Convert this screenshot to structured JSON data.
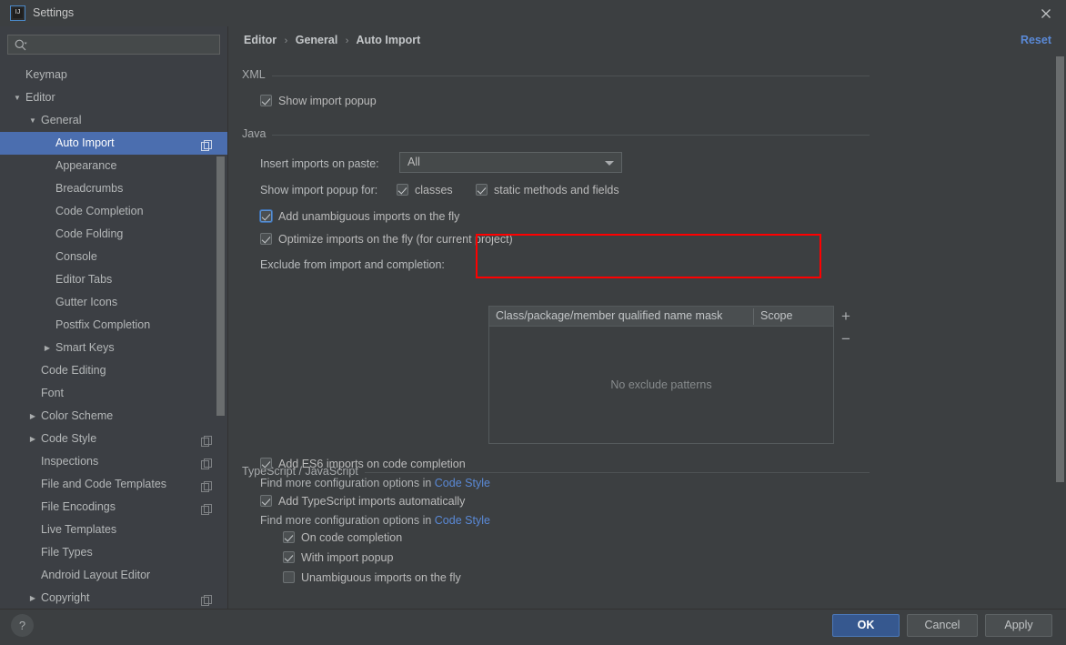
{
  "window": {
    "title": "Settings",
    "logo_text": "IJ",
    "close_icon": "close-icon"
  },
  "sidebar": {
    "search": {
      "value": "",
      "placeholder": "",
      "icon": "search-icon"
    },
    "items": [
      {
        "label": "Keymap",
        "level": 0,
        "arrow": "",
        "selected": false,
        "copy_icon": false
      },
      {
        "label": "Editor",
        "level": 0,
        "arrow": "▼",
        "selected": false,
        "copy_icon": false
      },
      {
        "label": "General",
        "level": 1,
        "arrow": "▼",
        "selected": false,
        "copy_icon": false
      },
      {
        "label": "Auto Import",
        "level": 2,
        "arrow": "",
        "selected": true,
        "copy_icon": true
      },
      {
        "label": "Appearance",
        "level": 2,
        "arrow": "",
        "selected": false,
        "copy_icon": false
      },
      {
        "label": "Breadcrumbs",
        "level": 2,
        "arrow": "",
        "selected": false,
        "copy_icon": false
      },
      {
        "label": "Code Completion",
        "level": 2,
        "arrow": "",
        "selected": false,
        "copy_icon": false
      },
      {
        "label": "Code Folding",
        "level": 2,
        "arrow": "",
        "selected": false,
        "copy_icon": false
      },
      {
        "label": "Console",
        "level": 2,
        "arrow": "",
        "selected": false,
        "copy_icon": false
      },
      {
        "label": "Editor Tabs",
        "level": 2,
        "arrow": "",
        "selected": false,
        "copy_icon": false
      },
      {
        "label": "Gutter Icons",
        "level": 2,
        "arrow": "",
        "selected": false,
        "copy_icon": false
      },
      {
        "label": "Postfix Completion",
        "level": 2,
        "arrow": "",
        "selected": false,
        "copy_icon": false
      },
      {
        "label": "Smart Keys",
        "level": 2,
        "arrow": "▶",
        "selected": false,
        "copy_icon": false
      },
      {
        "label": "Code Editing",
        "level": 1,
        "arrow": "",
        "selected": false,
        "copy_icon": false
      },
      {
        "label": "Font",
        "level": 1,
        "arrow": "",
        "selected": false,
        "copy_icon": false
      },
      {
        "label": "Color Scheme",
        "level": 1,
        "arrow": "▶",
        "selected": false,
        "copy_icon": false
      },
      {
        "label": "Code Style",
        "level": 1,
        "arrow": "▶",
        "selected": false,
        "copy_icon": true
      },
      {
        "label": "Inspections",
        "level": 1,
        "arrow": "",
        "selected": false,
        "copy_icon": true
      },
      {
        "label": "File and Code Templates",
        "level": 1,
        "arrow": "",
        "selected": false,
        "copy_icon": true
      },
      {
        "label": "File Encodings",
        "level": 1,
        "arrow": "",
        "selected": false,
        "copy_icon": true
      },
      {
        "label": "Live Templates",
        "level": 1,
        "arrow": "",
        "selected": false,
        "copy_icon": false
      },
      {
        "label": "File Types",
        "level": 1,
        "arrow": "",
        "selected": false,
        "copy_icon": false
      },
      {
        "label": "Android Layout Editor",
        "level": 1,
        "arrow": "",
        "selected": false,
        "copy_icon": false
      },
      {
        "label": "Copyright",
        "level": 1,
        "arrow": "▶",
        "selected": false,
        "copy_icon": true
      }
    ]
  },
  "content": {
    "breadcrumb": {
      "part1": "Editor",
      "part2": "General",
      "part3": "Auto Import",
      "separator": "›"
    },
    "reset_label": "Reset",
    "xml": {
      "group_title": "XML",
      "show_import_popup": {
        "label": "Show import popup",
        "checked": true
      }
    },
    "java": {
      "group_title": "Java",
      "insert_imports_label": "Insert imports on paste:",
      "insert_imports_value": "All",
      "show_import_popup_for_label": "Show import popup for:",
      "classes": {
        "label": "classes",
        "checked": true
      },
      "static_methods": {
        "label": "static methods and fields",
        "checked": true
      },
      "add_unambiguous": {
        "label": "Add unambiguous imports on the fly",
        "checked": true,
        "focused": true
      },
      "optimize_imports": {
        "label": "Optimize imports on the fly (for current project)",
        "checked": true
      },
      "exclude_label": "Exclude from import and completion:",
      "table": {
        "col1": "Class/package/member qualified name mask",
        "col2": "Scope",
        "empty_text": "No exclude patterns",
        "add_button": "+",
        "remove_button": "−"
      }
    },
    "ts_js": {
      "group_title": "TypeScript / JavaScript",
      "add_es6": {
        "label": "Add ES6 imports on code completion",
        "checked": true
      },
      "hint1_prefix": "Find more configuration options in ",
      "hint1_link": "Code Style",
      "add_ts": {
        "label": "Add TypeScript imports automatically",
        "checked": true
      },
      "hint2_prefix": "Find more configuration options in ",
      "hint2_link": "Code Style",
      "on_code_completion": {
        "label": "On code completion",
        "checked": true
      },
      "with_import_popup": {
        "label": "With import popup",
        "checked": true
      },
      "unambiguous_on_fly": {
        "label": "Unambiguous imports on the fly",
        "checked": false
      }
    }
  },
  "footer": {
    "help_label": "?",
    "ok_label": "OK",
    "cancel_label": "Cancel",
    "apply_label": "Apply"
  },
  "colors": {
    "accent": "#4b6eaf",
    "link": "#5a89d6",
    "highlight_box": "#ff0000",
    "background": "#3c3f41",
    "sidebar_bg": "#3c3f44"
  }
}
